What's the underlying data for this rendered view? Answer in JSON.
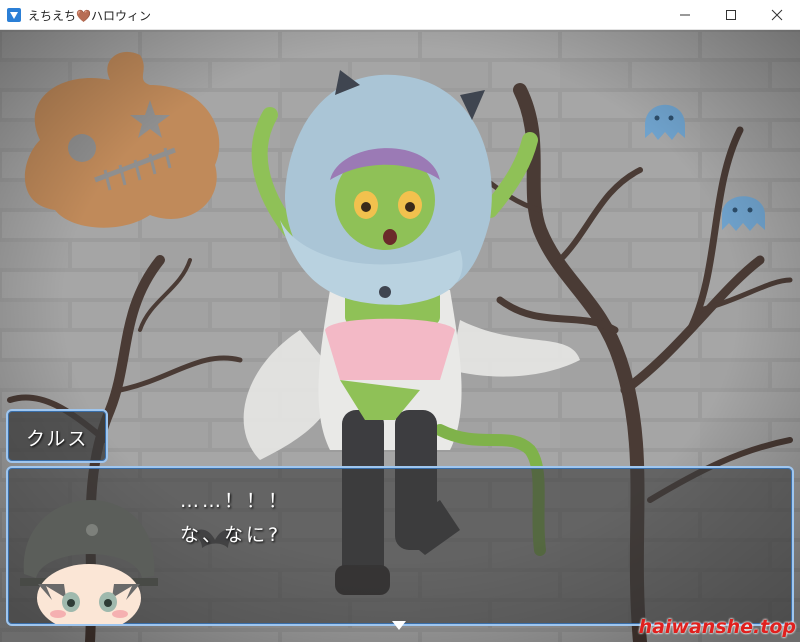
{
  "window": {
    "title": "えちえち🤎ハロウィン",
    "minimize_icon": "minimize-icon",
    "maximize_icon": "maximize-icon",
    "close_icon": "close-icon"
  },
  "dialogue": {
    "speaker": "クルス",
    "lines": [
      "……！！！",
      "な、なに?"
    ]
  },
  "watermark": "haiwanshe.top",
  "colors": {
    "window_border": "#9fc6ef",
    "pumpkin": "#c08a5a",
    "ghost": "#6fa2cc",
    "tree": "#4a3b35"
  }
}
